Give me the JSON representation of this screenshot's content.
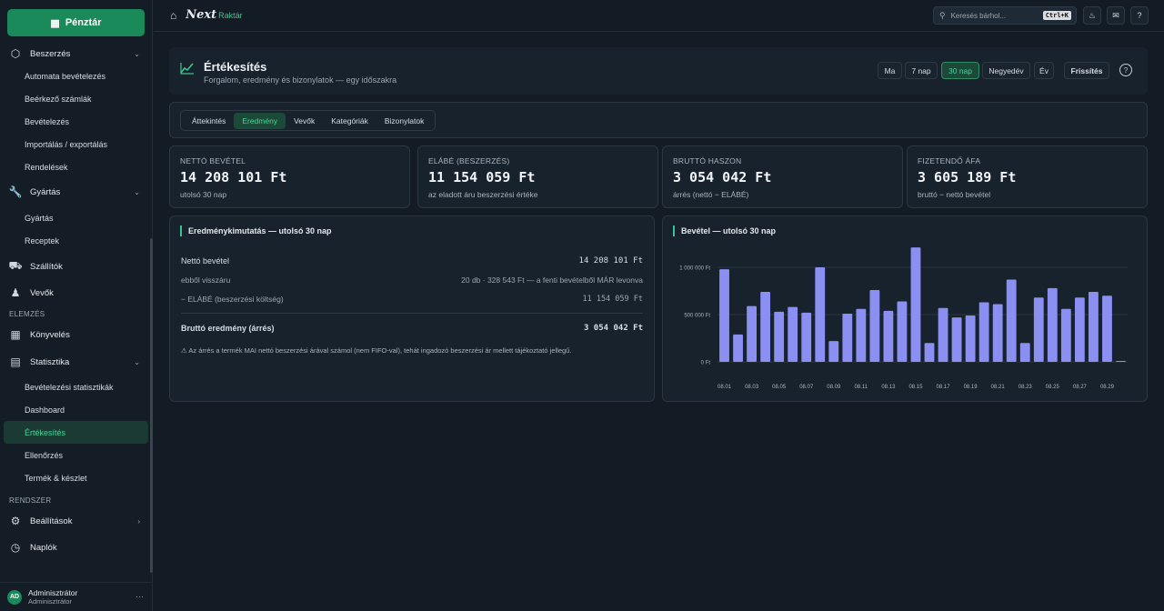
{
  "sidebar": {
    "cashier": "Pénztár",
    "purchase": {
      "label": "Beszerzés",
      "items": [
        "Automata bevételezés",
        "Beérkező számlák",
        "Bevételezés",
        "Importálás / exportálás",
        "Rendelések"
      ]
    },
    "production": {
      "label": "Gyártás",
      "items": [
        "Gyártás",
        "Receptek"
      ]
    },
    "suppliers": "Szállítók",
    "customers": "Vevők",
    "group_analysis": "ELEMZÉS",
    "accounting": "Könyvelés",
    "statistics": {
      "label": "Statisztika",
      "items": [
        "Bevételezési statisztikák",
        "Dashboard",
        "Értékesítés",
        "Ellenőrzés",
        "Termék & készlet"
      ]
    },
    "group_system": "RENDSZER",
    "settings": "Beállítások",
    "logs": "Naplók",
    "user": {
      "initials": "AD",
      "name": "Adminisztrátor",
      "role": "Adminisztrátor"
    }
  },
  "topbar": {
    "logo_name": "Next",
    "logo_sub": "Raktár",
    "search_placeholder": "Keresés bárhol...",
    "search_shortcut": "Ctrl+K"
  },
  "header": {
    "title": "Értékesítés",
    "subtitle": "Forgalom, eredmény és bizonylatok — egy időszakra",
    "ranges": [
      "Ma",
      "7 nap",
      "30 nap",
      "Negyedév",
      "Év"
    ],
    "active_range": "30 nap",
    "refresh": "Frissítés"
  },
  "tabs": {
    "items": [
      "Áttekintés",
      "Eredmény",
      "Vevők",
      "Kategóriák",
      "Bizonylatok"
    ],
    "active": "Eredmény"
  },
  "kpis": [
    {
      "label": "NETTÓ BEVÉTEL",
      "value": "14 208 101 Ft",
      "sub": "utolsó 30 nap"
    },
    {
      "label": "ELÁBÉ (BESZERZÉS)",
      "value": "11 154 059 Ft",
      "sub": "az eladott áru beszerzési értéke"
    },
    {
      "label": "BRUTTÓ HASZON",
      "value": "3 054 042 Ft",
      "sub": "árrés (nettó − ELÁBÉ)"
    },
    {
      "label": "FIZETENDŐ ÁFA",
      "value": "3 605 189 Ft",
      "sub": "bruttó − nettó bevétel"
    }
  ],
  "income": {
    "title": "Eredménykimutatás — utolsó 30 nap",
    "net_label": "Nettó bevétel",
    "net_value": "14 208 101 Ft",
    "returns_label": "ebből visszáru",
    "returns_value": "20 db · 328 543 Ft — a fenti bevételből MÁR levonva",
    "cogs_label": "− ELÁBÉ (beszerzési költség)",
    "cogs_value": "11 154 059 Ft",
    "gross_label": "Bruttó eredmény (árrés)",
    "gross_value": "3 054 042 Ft",
    "note": "Az árrés a termék MAI nettó beszerzési árával számol (nem FIFO-val), tehát ingadozó beszerzési ár mellett tájékoztató jellegű."
  },
  "chart_data": {
    "type": "bar",
    "title": "Bevétel — utolsó 30 nap",
    "categories": [
      "08.01",
      "08.02",
      "08.03",
      "08.04",
      "08.05",
      "08.06",
      "08.07",
      "08.08",
      "08.09",
      "08.10",
      "08.11",
      "08.12",
      "08.13",
      "08.14",
      "08.15",
      "08.16",
      "08.17",
      "08.18",
      "08.19",
      "08.20",
      "08.21",
      "08.22",
      "08.23",
      "08.24",
      "08.25",
      "08.26",
      "08.27",
      "08.28",
      "08.29",
      "08.30"
    ],
    "tick_labels": [
      "08.01",
      "08.03",
      "08.05",
      "08.07",
      "08.09",
      "08.11",
      "08.13",
      "08.15",
      "08.17",
      "08.19",
      "08.21",
      "08.23",
      "08.25",
      "08.27",
      "08.29"
    ],
    "values": [
      980000,
      290000,
      590000,
      740000,
      530000,
      580000,
      520000,
      1000000,
      220000,
      510000,
      560000,
      760000,
      540000,
      640000,
      1210000,
      200000,
      570000,
      470000,
      490000,
      630000,
      610000,
      870000,
      200000,
      680000,
      780000,
      560000,
      680000,
      740000,
      700000,
      10000
    ],
    "ytick_labels": [
      "0 Ft",
      "500 000 Ft",
      "1 000 000 Ft"
    ],
    "yticks": [
      0,
      500000,
      1000000
    ],
    "ylim": [
      0,
      1250000
    ],
    "color": "#8b8ff2"
  }
}
